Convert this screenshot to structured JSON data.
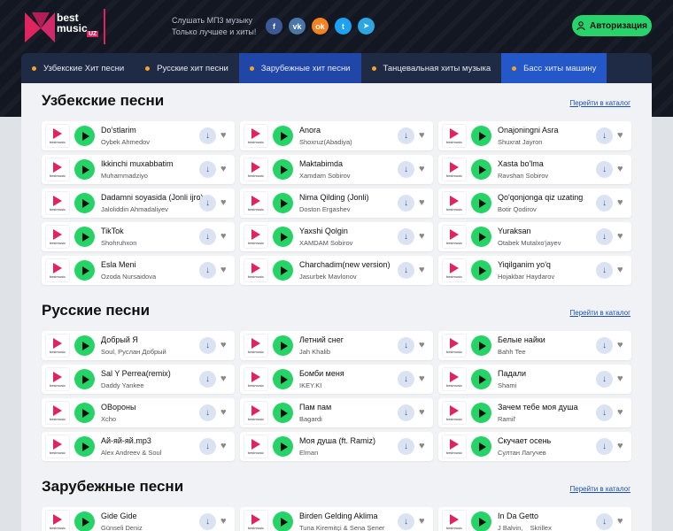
{
  "header": {
    "logo_text": "best music",
    "logo_badge": "UZ",
    "tagline_line1": "Слушать МП3 музыку",
    "tagline_line2": "Только лучшее и хиты!",
    "socials": [
      {
        "icon": "facebook-icon",
        "glyph": "f",
        "color": "#3b5998"
      },
      {
        "icon": "vk-icon",
        "glyph": "vk",
        "color": "#4a76a8"
      },
      {
        "icon": "odnoklassniki-icon",
        "glyph": "ok",
        "color": "#f58220"
      },
      {
        "icon": "twitter-icon",
        "glyph": "t",
        "color": "#1da1f2"
      },
      {
        "icon": "telegram-icon",
        "glyph": "➤",
        "color": "#2ca5e0"
      }
    ],
    "auth_label": "Авторизация"
  },
  "nav": [
    "Узбекские Хит песни",
    "Русские хит песни",
    "Зарубежные хит песни",
    "Танцевальная хиты музыка",
    "Басс хиты машину"
  ],
  "catalog_label": "Перейти в каталог",
  "thumb_label": "bestmusic",
  "sections": [
    {
      "title": "Узбекские песни",
      "tracks": [
        {
          "title": "Do'stlarim",
          "artist": "Oybek Ahmedov"
        },
        {
          "title": "Anora",
          "artist": "Shoxruz(Abadiya)"
        },
        {
          "title": "Onajoningni Asra",
          "artist": "Shuxrat Jayron"
        },
        {
          "title": "Ikkinchi muxabbatim",
          "artist": "Muhammadziyo"
        },
        {
          "title": "Maktabimda",
          "artist": "Xamdam Sobirov"
        },
        {
          "title": "Xasta bo'lma",
          "artist": "Ravshan Sobirov"
        },
        {
          "title": "Dadamni soyasida (Jonli ijro)",
          "artist": "Jaloliddin Ahmadaliyev"
        },
        {
          "title": "Nima Qilding (Jonli)",
          "artist": "Doston Ergashev"
        },
        {
          "title": "Qo'qonjonga qiz uzating",
          "artist": "Botir Qodirov"
        },
        {
          "title": "TikTok",
          "artist": "Shohruhxon"
        },
        {
          "title": "Yaxshi Qolgin",
          "artist": "XAMDAM Sobirov"
        },
        {
          "title": "Yuraksan",
          "artist": "Otabek Mutalxo'jayev"
        },
        {
          "title": "Esla Meni",
          "artist": "Ozoda Nursaidova"
        },
        {
          "title": "Charchadim(new version)",
          "artist": "Jasurbek Mavlonov"
        },
        {
          "title": "Yiqilganim yo'q",
          "artist": "Hojakbar Haydarov"
        }
      ]
    },
    {
      "title": "Русские песни",
      "tracks": [
        {
          "title": "Добрый Я",
          "artist": "Soul, Руслан Добрый"
        },
        {
          "title": "Летний снег",
          "artist": "Jah Khalib"
        },
        {
          "title": "Белые найки",
          "artist": "Bahh Tee"
        },
        {
          "title": "Sal Y Perrea(remix)",
          "artist": "Daddy Yankee"
        },
        {
          "title": "Бомби меня",
          "artist": "IKEY.KI"
        },
        {
          "title": "Падали",
          "artist": "Shami"
        },
        {
          "title": "ОВороны",
          "artist": "Xcho"
        },
        {
          "title": "Пам пам",
          "artist": "Bagardi"
        },
        {
          "title": "Зачем тебе моя душа",
          "artist": "Ramil'"
        },
        {
          "title": "Ай-яй-яй.mp3",
          "artist": "Alex Andreev & Soul"
        },
        {
          "title": "Моя душа (ft. Ramiz)",
          "artist": "Elman"
        },
        {
          "title": "Скучает осень",
          "artist": "Султан Лагучев"
        }
      ]
    },
    {
      "title": "Зарубежные песни",
      "tracks": [
        {
          "title": "Gide Gide",
          "artist": "Günseli Deniz"
        },
        {
          "title": "Birden Gelding Aklima",
          "artist": "Tuna Kiremitçi & Sena Şener"
        },
        {
          "title": "In Da Getto",
          "artist": "J Balvin, _ Skrillex"
        }
      ]
    }
  ]
}
